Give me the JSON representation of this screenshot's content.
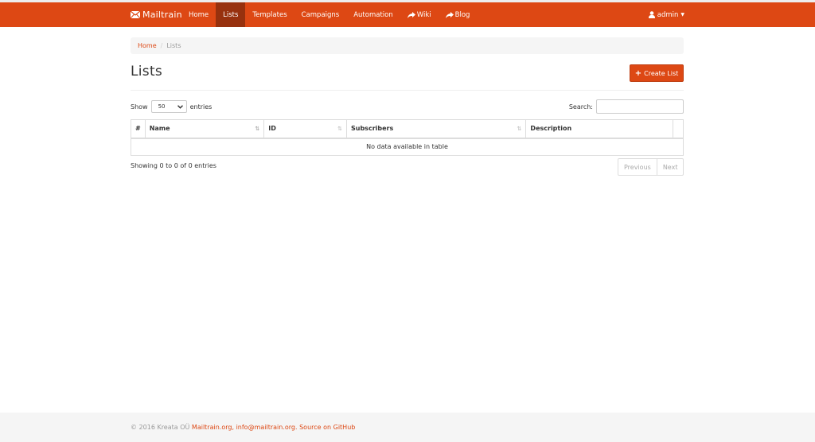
{
  "navbar": {
    "brand": "Mailtrain",
    "links": [
      {
        "label": "Home",
        "active": false
      },
      {
        "label": "Lists",
        "active": true
      },
      {
        "label": "Templates",
        "active": false
      },
      {
        "label": "Campaigns",
        "active": false
      },
      {
        "label": "Automation",
        "active": false
      },
      {
        "label": "Wiki",
        "active": false
      },
      {
        "label": "Blog",
        "active": false
      }
    ],
    "user": "admin",
    "brand_color": "#dd4814",
    "active_color": "#97310e"
  },
  "breadcrumb": {
    "home": "Home",
    "separator": "/",
    "current": "Lists"
  },
  "page": {
    "title": "Lists",
    "create_button": "Create List"
  },
  "table_controls": {
    "show_label": "Show",
    "page_size": "50",
    "entries_label": "entries",
    "search_label": "Search:",
    "search_value": ""
  },
  "table": {
    "columns": [
      "#",
      "Name",
      "ID",
      "Subscribers",
      "Description"
    ],
    "empty_message": "No data available in table",
    "info": "Showing 0 to 0 of 0 entries",
    "prev": "Previous",
    "next": "Next"
  },
  "footer": {
    "copyright": "© 2016 Kreata OÜ",
    "link_site": "Mailtrain.org",
    "sep1": ",",
    "link_email": "info@mailtrain.org",
    "sep2": ".",
    "link_source": "Source on GitHub"
  }
}
